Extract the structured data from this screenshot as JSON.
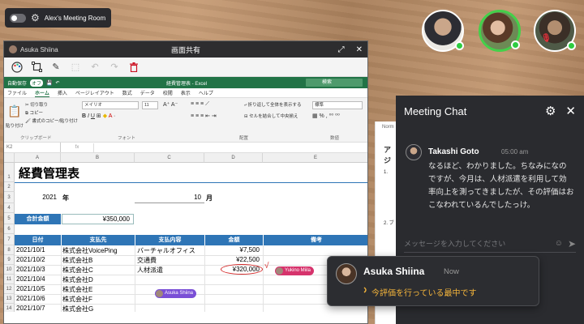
{
  "room": {
    "name": "Alex's Meeting Room"
  },
  "share": {
    "owner": "Asuka Shiina",
    "title": "画面共有"
  },
  "excel": {
    "autosave": "自動保存",
    "autosave_state": "オフ",
    "filename": "経費管理表 - Excel",
    "search_placeholder": "検索",
    "tabs": [
      "ファイル",
      "ホーム",
      "挿入",
      "ページレイアウト",
      "数式",
      "データ",
      "校閲",
      "表示",
      "ヘルプ"
    ],
    "ribbon": {
      "paste": "貼り付け",
      "cut": "切り取り",
      "copy": "コピー",
      "format_painter": "書式のコピー/貼り付け",
      "clipboard": "クリップボード",
      "font_name": "メイリオ",
      "font_size": "11",
      "font": "フォント",
      "wrap_text": "折り返して全体を表示する",
      "merge_center": "セルを結合して中央揃え",
      "alignment": "配置",
      "number_format": "標準",
      "number": "数値"
    },
    "namebox": "K2",
    "fx": "fx",
    "columns": [
      "A",
      "B",
      "C",
      "D",
      "E"
    ],
    "rows": [
      "1",
      "2",
      "3",
      "4",
      "5",
      "6",
      "7",
      "8",
      "9",
      "10",
      "11",
      "12",
      "13",
      "14"
    ],
    "sheet_title": "経費管理表",
    "year": "2021",
    "year_label": "年",
    "month": "10",
    "month_label": "月",
    "total_label": "合計金額",
    "total_value": "¥350,000",
    "headers": [
      "日付",
      "支払先",
      "支払内容",
      "金額",
      "備考"
    ],
    "data_rows": [
      [
        "2021/10/1",
        "株式会社VoicePing",
        "バーチャルオフィス",
        "¥7,500"
      ],
      [
        "2021/10/2",
        "株式会社B",
        "交通費",
        "¥22,500"
      ],
      [
        "2021/10/3",
        "株式会社C",
        "人材派遣",
        "¥320,000"
      ],
      [
        "2021/10/4",
        "株式会社D",
        "",
        ""
      ],
      [
        "2021/10/5",
        "株式会社E",
        "",
        ""
      ],
      [
        "2021/10/6",
        "株式会社F",
        "",
        ""
      ],
      [
        "2021/10/7",
        "株式会社G",
        "",
        ""
      ]
    ]
  },
  "cursors": [
    {
      "name": "Yukino Miila",
      "color": "#d6336c"
    },
    {
      "name": "Asuka Shiina",
      "color": "#7a4fd6"
    }
  ],
  "chat": {
    "title": "Meeting Chat",
    "message": {
      "sender": "Takashi Goto",
      "time": "05:00 am",
      "text": "なるほど、わかりました。ちなみになのですが、今月は、人材派遣を利用して効率向上を測ってきましたが、その評価はおこなわれているんでしたっけ。"
    },
    "input_placeholder": "メッセージを入力してください"
  },
  "doc_peek": {
    "style": "Norm",
    "heading": "アジ",
    "item1": "1.",
    "item2": "2. ブ"
  },
  "notification": {
    "name": "Asuka Shiina",
    "time": "Now",
    "status": "今評価を行っている最中です"
  },
  "colors": {
    "excel_green": "#217346",
    "table_header_blue": "#2e75b6",
    "status_yellow": "#f5b53b",
    "online_green": "#2ecc40"
  }
}
